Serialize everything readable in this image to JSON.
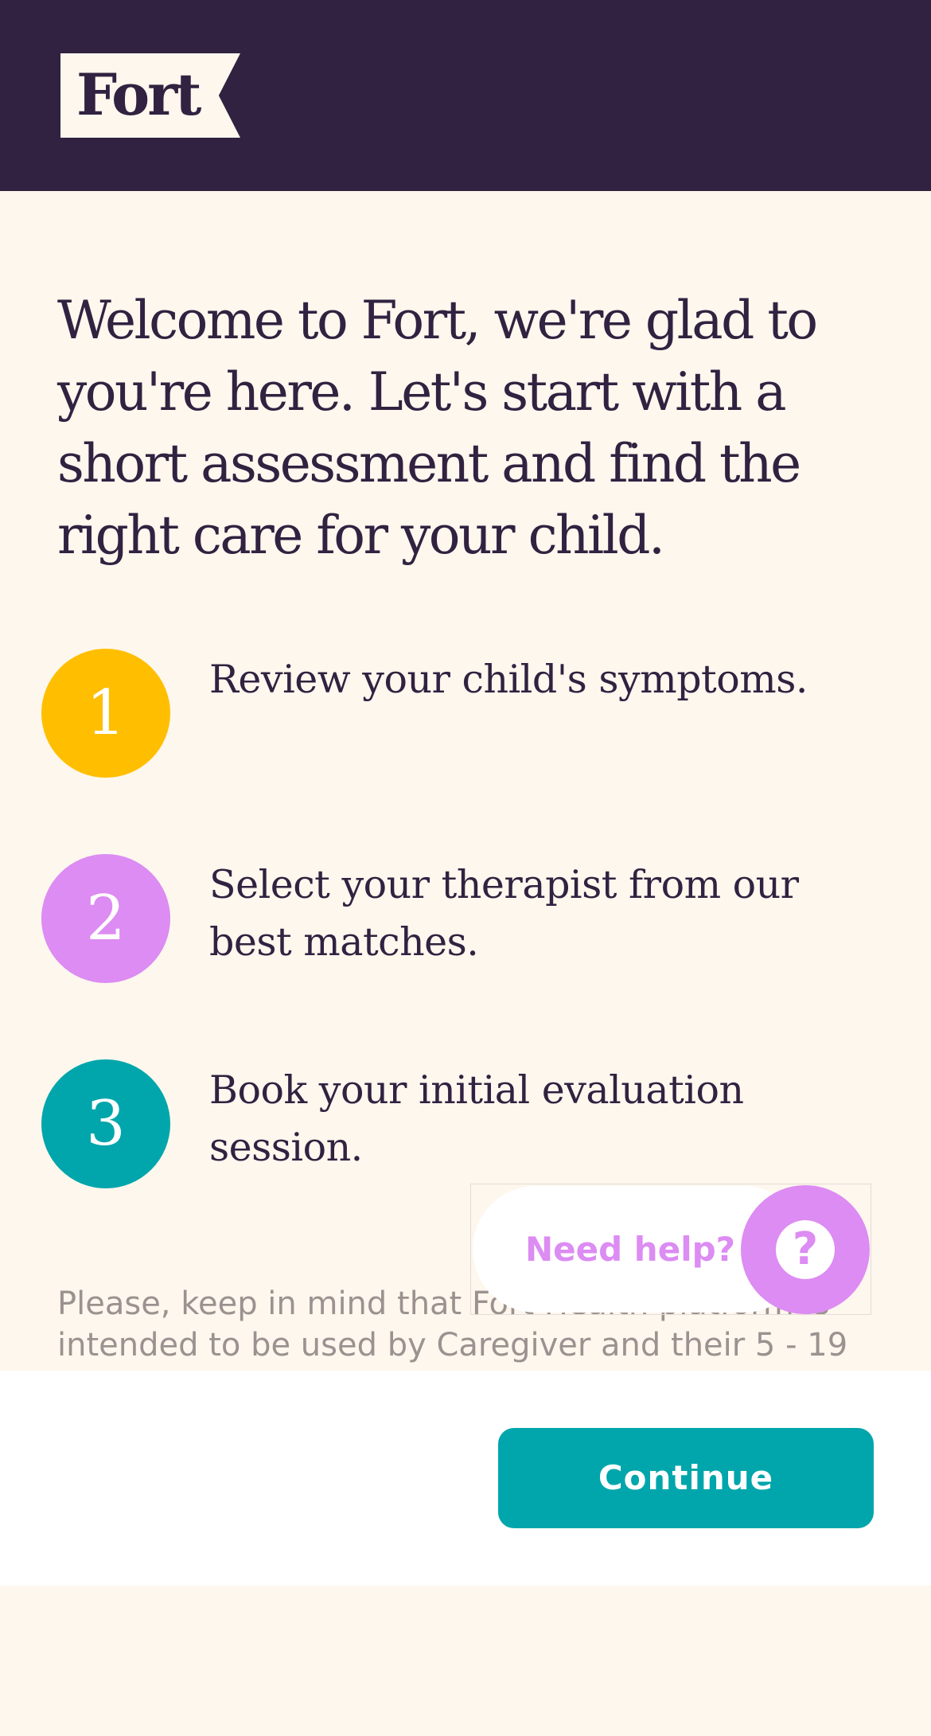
{
  "header": {
    "logo_text": "Fort"
  },
  "colors": {
    "header_bg": "#302240",
    "page_bg": "#fdf7ee",
    "step1": "#ffbf00",
    "step2": "#dc8cf2",
    "step3": "#00a6ab",
    "accent_teal": "#00a6ab",
    "help_pink": "#dc8cf2"
  },
  "main": {
    "heading": "Welcome to Fort, we're glad to you're here. Let's start with a short assessment and find the right care for your child.",
    "steps": [
      {
        "number": "1",
        "text": "Review your child's symptoms."
      },
      {
        "number": "2",
        "text": "Select your therapist from our best matches."
      },
      {
        "number": "3",
        "text": "Book your initial evaluation session."
      }
    ],
    "disclaimer": "Please, keep in mind that Fort Health platform is intended to be used by Caregiver and their 5 - 19"
  },
  "help": {
    "label": "Need help?",
    "icon": "question-icon",
    "icon_glyph": "?"
  },
  "footer": {
    "continue_label": "Continue"
  }
}
